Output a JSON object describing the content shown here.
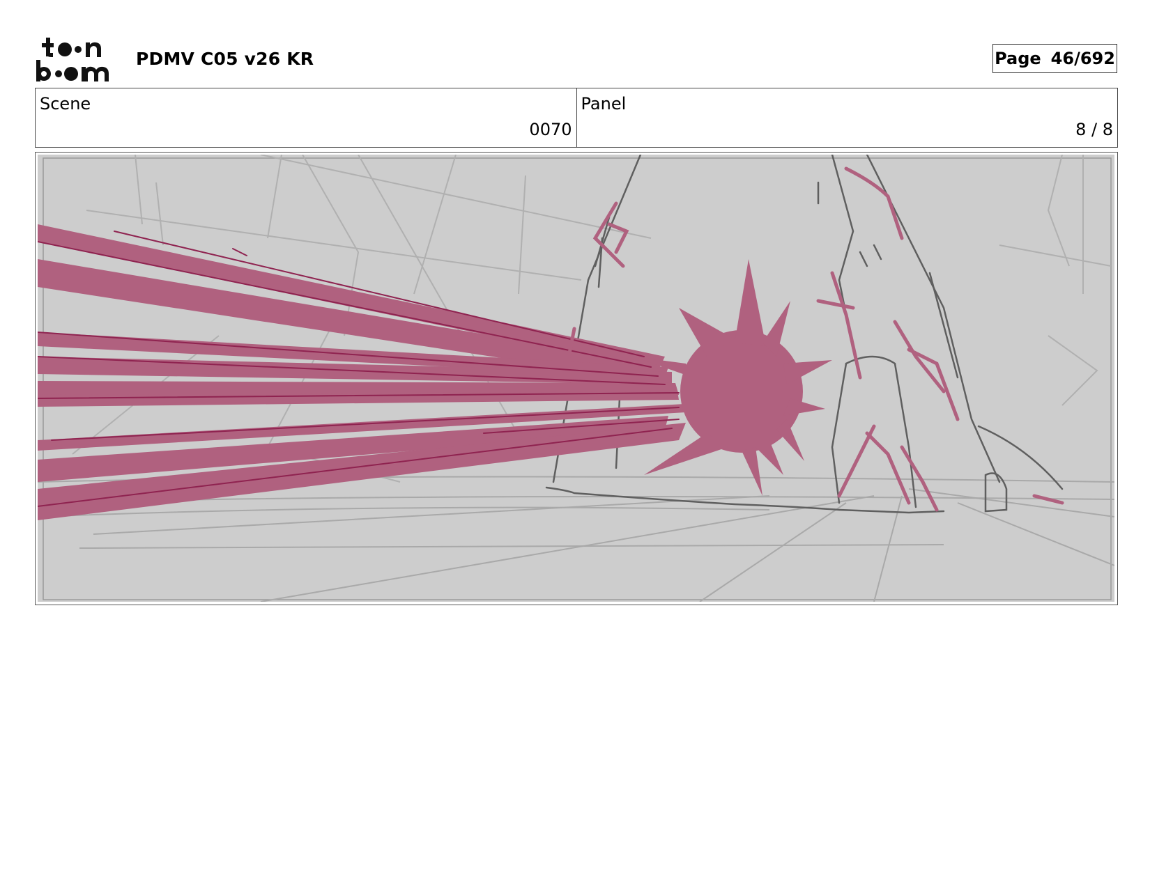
{
  "header": {
    "logo_text": "toon boom",
    "title": "PDMV C05 v26 KR",
    "page_label": "Page",
    "page_value": "46/692"
  },
  "info": {
    "scene_label": "Scene",
    "scene_value": "0070",
    "panel_label": "Panel",
    "panel_value": "8 / 8"
  },
  "colors": {
    "sketch_bg": "#cdcdcd",
    "blast": "#b0617f",
    "blast_line": "#8f2350",
    "line_dark": "#5f5f5f",
    "line_light": "#a9a9a9"
  }
}
